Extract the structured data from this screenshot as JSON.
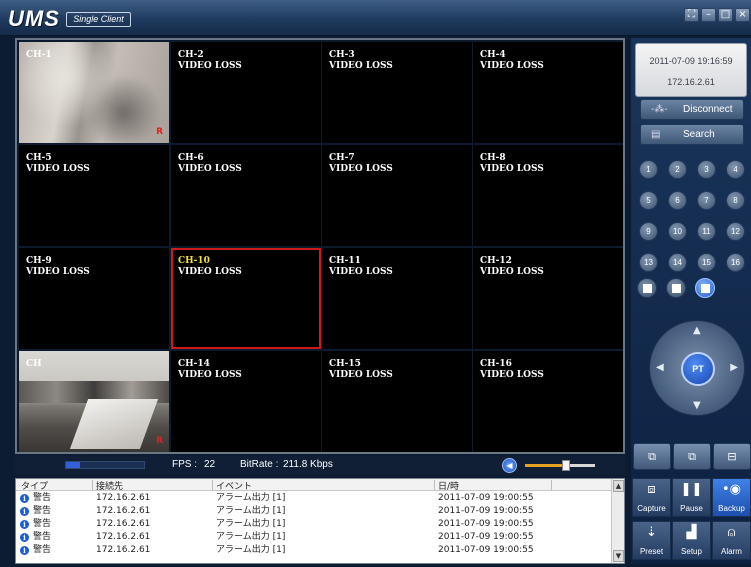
{
  "app": {
    "logo": "UMS",
    "subtitle": "Single Client"
  },
  "window_controls": [
    "fullscreen-icon",
    "minimize-icon",
    "maximize-icon",
    "close-icon"
  ],
  "channels": [
    {
      "ch": "CH-1",
      "status": "",
      "feed": true,
      "rec": "R"
    },
    {
      "ch": "CH-2",
      "status": "VIDEO LOSS",
      "feed": false,
      "rec": ""
    },
    {
      "ch": "CH-3",
      "status": "VIDEO LOSS",
      "feed": false,
      "rec": ""
    },
    {
      "ch": "CH-4",
      "status": "VIDEO LOSS",
      "feed": false,
      "rec": ""
    },
    {
      "ch": "CH-5",
      "status": "VIDEO LOSS",
      "feed": false,
      "rec": ""
    },
    {
      "ch": "CH-6",
      "status": "VIDEO LOSS",
      "feed": false,
      "rec": ""
    },
    {
      "ch": "CH-7",
      "status": "VIDEO LOSS",
      "feed": false,
      "rec": ""
    },
    {
      "ch": "CH-8",
      "status": "VIDEO LOSS",
      "feed": false,
      "rec": ""
    },
    {
      "ch": "CH-9",
      "status": "VIDEO LOSS",
      "feed": false,
      "rec": ""
    },
    {
      "ch": "CH-10",
      "status": "VIDEO LOSS",
      "feed": false,
      "rec": "",
      "selected": true
    },
    {
      "ch": "CH-11",
      "status": "VIDEO LOSS",
      "feed": false,
      "rec": ""
    },
    {
      "ch": "CH-12",
      "status": "VIDEO LOSS",
      "feed": false,
      "rec": ""
    },
    {
      "ch": "CH",
      "status": "",
      "feed": true,
      "rec": "R"
    },
    {
      "ch": "CH-14",
      "status": "VIDEO LOSS",
      "feed": false,
      "rec": ""
    },
    {
      "ch": "CH-15",
      "status": "VIDEO LOSS",
      "feed": false,
      "rec": ""
    },
    {
      "ch": "CH-16",
      "status": "VIDEO LOSS",
      "feed": false,
      "rec": ""
    }
  ],
  "status": {
    "fps_label": "FPS :",
    "fps": "22",
    "bitrate_label": "BitRate :",
    "bitrate": "211.8 Kbps",
    "progress": 0.18,
    "volume": 0.55
  },
  "log": {
    "headers": [
      "タイプ",
      "接続先",
      "イベント",
      "日/時"
    ],
    "rows": [
      {
        "type": "警告",
        "host": "172.16.2.61",
        "event": "アラーム出力 [1]",
        "time": "2011-07-09 19:00:55"
      },
      {
        "type": "警告",
        "host": "172.16.2.61",
        "event": "アラーム出力 [1]",
        "time": "2011-07-09 19:00:55"
      },
      {
        "type": "警告",
        "host": "172.16.2.61",
        "event": "アラーム出力 [1]",
        "time": "2011-07-09 19:00:55"
      },
      {
        "type": "警告",
        "host": "172.16.2.61",
        "event": "アラーム出力 [1]",
        "time": "2011-07-09 19:00:55"
      },
      {
        "type": "警告",
        "host": "172.16.2.61",
        "event": "アラーム出力 [1]",
        "time": "2011-07-09 19:00:55"
      }
    ]
  },
  "panel": {
    "datetime": "2011-07-09 19:16:59",
    "ip": "172.16.2.61",
    "disconnect_label": "Disconnect",
    "search_label": "Search",
    "numbers": [
      "1",
      "2",
      "3",
      "4",
      "5",
      "6",
      "7",
      "8",
      "9",
      "10",
      "11",
      "12",
      "13",
      "14",
      "15",
      "16"
    ],
    "ptz_label": "PT",
    "actions": [
      "Capture",
      "Pause",
      "Backup",
      "Preset",
      "Setup",
      "Alarm"
    ]
  },
  "colors": {
    "accent": "#2960c8",
    "selected_border": "#d01818",
    "selected_label": "#f0e040"
  }
}
